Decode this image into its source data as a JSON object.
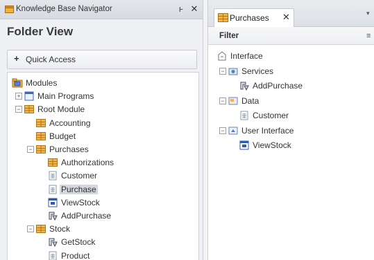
{
  "navigator": {
    "title": "Knowledge Base Navigator",
    "pin_glyph": "ͱ",
    "close_glyph": "✕",
    "section_title": "Folder View",
    "quick_access": {
      "icon": "+",
      "label": "Quick Access"
    },
    "tree": [
      {
        "label": "Modules",
        "icon": "modules-icon",
        "level": 0,
        "expander": "",
        "selected": false
      },
      {
        "label": "Main Programs",
        "icon": "main-programs-icon",
        "level": 1,
        "expander": "+",
        "selected": false
      },
      {
        "label": "Root Module",
        "icon": "module-icon",
        "level": 1,
        "expander": "−",
        "selected": false
      },
      {
        "label": "Accounting",
        "icon": "module-icon",
        "level": 2,
        "expander": "",
        "selected": false
      },
      {
        "label": "Budget",
        "icon": "module-icon",
        "level": 2,
        "expander": "",
        "selected": false
      },
      {
        "label": "Purchases",
        "icon": "module-icon",
        "level": 2,
        "expander": "−",
        "selected": false
      },
      {
        "label": "Authorizations",
        "icon": "module-icon",
        "level": 3,
        "expander": "",
        "selected": false
      },
      {
        "label": "Customer",
        "icon": "table-icon",
        "level": 3,
        "expander": "",
        "selected": false
      },
      {
        "label": "Purchase",
        "icon": "table-icon",
        "level": 3,
        "expander": "",
        "selected": true
      },
      {
        "label": "ViewStock",
        "icon": "panel-icon",
        "level": 3,
        "expander": "",
        "selected": false
      },
      {
        "label": "AddPurchase",
        "icon": "procedure-icon",
        "level": 3,
        "expander": "",
        "selected": false
      },
      {
        "label": "Stock",
        "icon": "module-icon",
        "level": 2,
        "expander": "−",
        "selected": false
      },
      {
        "label": "GetStock",
        "icon": "procedure-icon",
        "level": 3,
        "expander": "",
        "selected": false
      },
      {
        "label": "Product",
        "icon": "table-icon",
        "level": 3,
        "expander": "",
        "selected": false
      }
    ]
  },
  "purchases_panel": {
    "tab_label": "Purchases",
    "tab_close": "✕",
    "tab_dropdown": "▾",
    "filter_label": "Filter",
    "filter_menu": "≡",
    "tree": [
      {
        "label": "Interface",
        "icon": "interface-icon",
        "level": 0,
        "expander": ""
      },
      {
        "label": "Services",
        "icon": "services-icon",
        "level": 1,
        "expander": "−"
      },
      {
        "label": "AddPurchase",
        "icon": "procedure-icon",
        "level": 2,
        "expander": ""
      },
      {
        "label": "Data",
        "icon": "data-icon",
        "level": 1,
        "expander": "−"
      },
      {
        "label": "Customer",
        "icon": "table-icon",
        "level": 2,
        "expander": ""
      },
      {
        "label": "User Interface",
        "icon": "user-interface-icon",
        "level": 1,
        "expander": "−"
      },
      {
        "label": "ViewStock",
        "icon": "panel-icon",
        "level": 2,
        "expander": ""
      }
    ]
  }
}
